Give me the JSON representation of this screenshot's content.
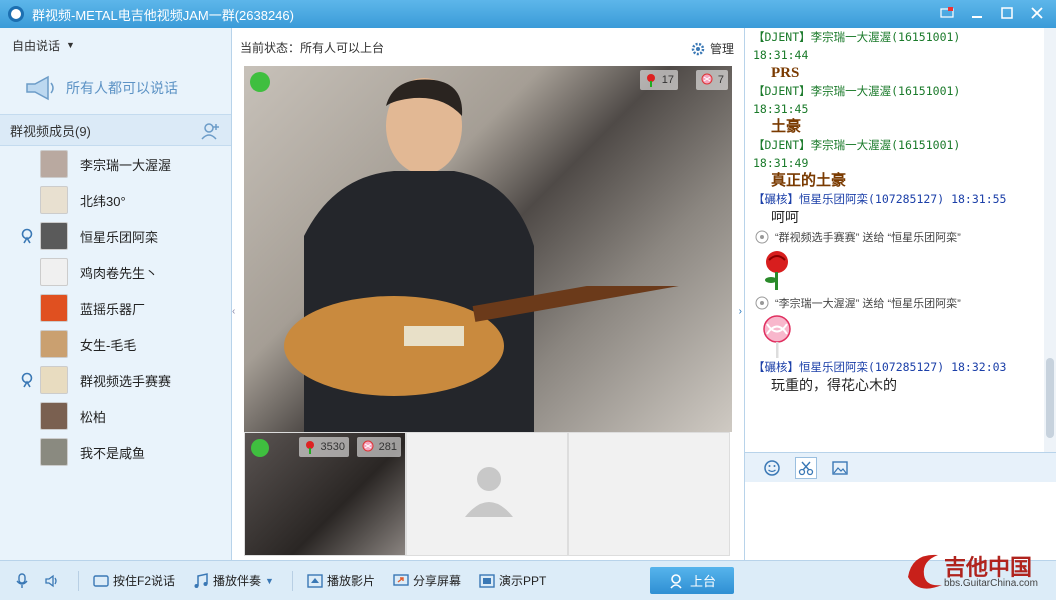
{
  "window": {
    "title": "群视频-METAL电吉他视频JAM一群(2638246)",
    "controls": [
      "skin-icon",
      "minimize-icon",
      "maximize-icon",
      "close-icon"
    ]
  },
  "left": {
    "speak_mode": "自由说话",
    "everyone_speak": "所有人都可以说话",
    "members_header": "群视频成员(9)",
    "members": [
      {
        "name": "李宗瑞一大渥渥",
        "mic": false
      },
      {
        "name": "北纬30°",
        "mic": false
      },
      {
        "name": "恒星乐团阿栾",
        "mic": true
      },
      {
        "name": "鸡肉卷先生丶",
        "mic": false
      },
      {
        "name": "蓝摇乐器厂",
        "mic": false
      },
      {
        "name": "女生-毛毛",
        "mic": false
      },
      {
        "name": "群视频选手赛赛",
        "mic": true
      },
      {
        "name": "松柏",
        "mic": false
      },
      {
        "name": "我不是咸鱼",
        "mic": false
      }
    ]
  },
  "center": {
    "status_label": "当前状态：所有人可以上台",
    "manage_label": "管理",
    "main_video": {
      "roses": "17",
      "lollipops": "7"
    },
    "thumbs": [
      {
        "roses": "3530",
        "lollipops": "281"
      }
    ]
  },
  "chat": {
    "messages": [
      {
        "head": "【DJENT】李宗瑞一大渥渥(16151001)",
        "time": "18:31:44",
        "body": "PRS"
      },
      {
        "head": "【DJENT】李宗瑞一大渥渥(16151001)",
        "time": "18:31:45",
        "body": "土豪"
      },
      {
        "head": "【DJENT】李宗瑞一大渥渥(16151001)",
        "time": "18:31:49",
        "body": "真正的土豪"
      }
    ],
    "msg4_head": "【碾核】恒星乐团阿栾(107285127)  18:31:55",
    "msg4_body": "呵呵",
    "gift1": "“群视频选手赛赛” 送给 “恒星乐团阿栾”",
    "gift2": "“李宗瑞一大渥渥” 送给 “恒星乐团阿栾”",
    "msg5_head": "【碾核】恒星乐团阿栾(107285127)  18:32:03",
    "msg5_body": "玩重的，得花心木的"
  },
  "toolbar": {
    "f2_talk": "按住F2说话",
    "play_music": "播放伴奏",
    "play_movie": "播放影片",
    "share_screen": "分享屏幕",
    "present_ppt": "演示PPT",
    "on_stage": "上台"
  },
  "watermark": {
    "text": "吉他中国",
    "sub": "bbs.GuitarChina.com"
  },
  "colors": {
    "accent": "#3a9bd8",
    "chat_green": "#1a7a2a",
    "chat_blue": "#1b3fa8"
  }
}
